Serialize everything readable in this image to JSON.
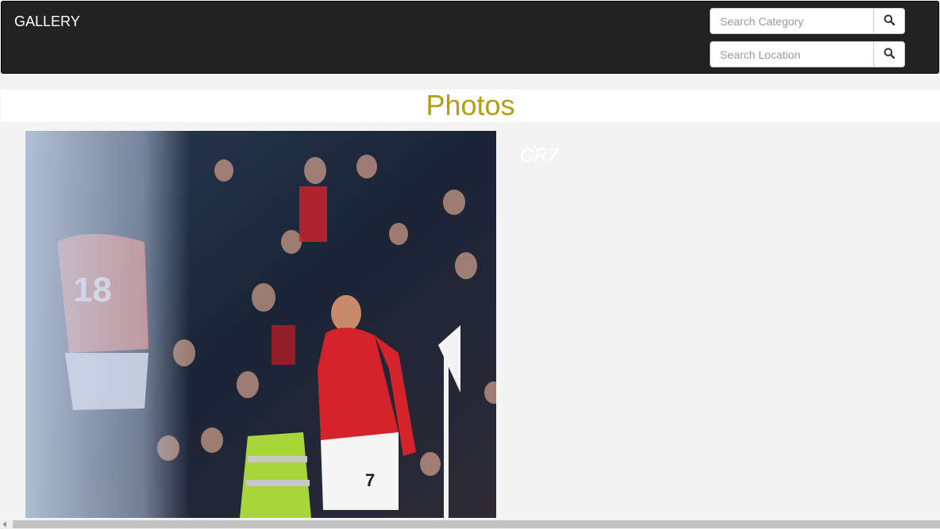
{
  "navbar": {
    "brand": "GALLERY",
    "search_category": {
      "placeholder": "Search Category",
      "icon": "search-icon"
    },
    "search_location": {
      "placeholder": "Search Location",
      "icon": "search-icon"
    }
  },
  "main": {
    "title": "Photos",
    "title_color": "#b59c11",
    "photo": {
      "caption": "CR7"
    }
  }
}
